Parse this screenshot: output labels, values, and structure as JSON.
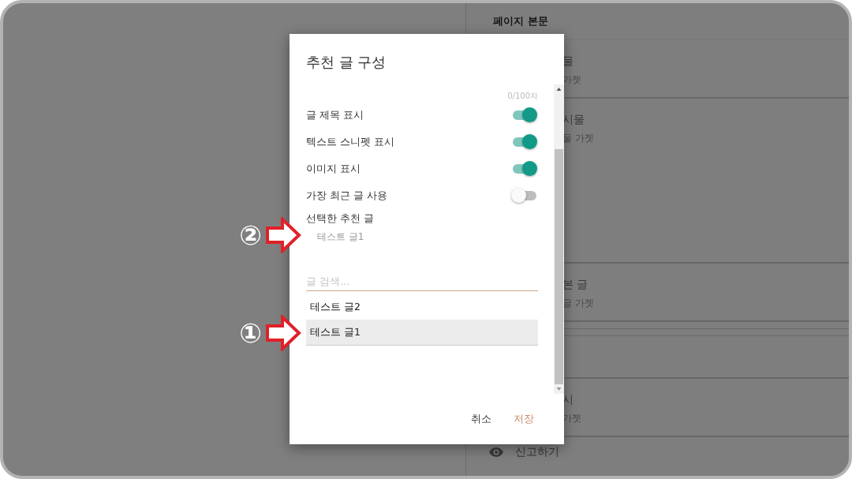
{
  "panel": {
    "title": "페이지 본문",
    "cards": [
      {
        "title": "물",
        "subtitle": "가젯",
        "kind": "short"
      },
      {
        "title": "시물",
        "subtitle": "물 가젯",
        "kind": "tall"
      },
      {
        "title": "본 글",
        "subtitle": "글 가젯",
        "kind": "short"
      },
      {
        "title": "시",
        "subtitle": "가젯",
        "kind": "short"
      }
    ],
    "report": {
      "label": "신고하기"
    }
  },
  "dialog": {
    "title": "추천 글 구성",
    "counter": "0/100자",
    "toggles": [
      {
        "label": "글 제목 표시",
        "on": true
      },
      {
        "label": "텍스트 스니펫 표시",
        "on": true
      },
      {
        "label": "이미지 표시",
        "on": true
      },
      {
        "label": "가장 최근 글 사용",
        "on": false
      }
    ],
    "selected_heading": "선택한 추천 글",
    "selected_items": [
      {
        "label": "테스트 글1",
        "marker": "②"
      }
    ],
    "search": {
      "placeholder": "글 검색..."
    },
    "results": [
      {
        "label": "테스트 글2",
        "selected": false
      },
      {
        "label": "테스트 글1",
        "selected": true,
        "marker": "①"
      }
    ],
    "buttons": [
      {
        "label": "취소",
        "kind": "cancel"
      },
      {
        "label": "저장",
        "kind": "save"
      }
    ]
  }
}
